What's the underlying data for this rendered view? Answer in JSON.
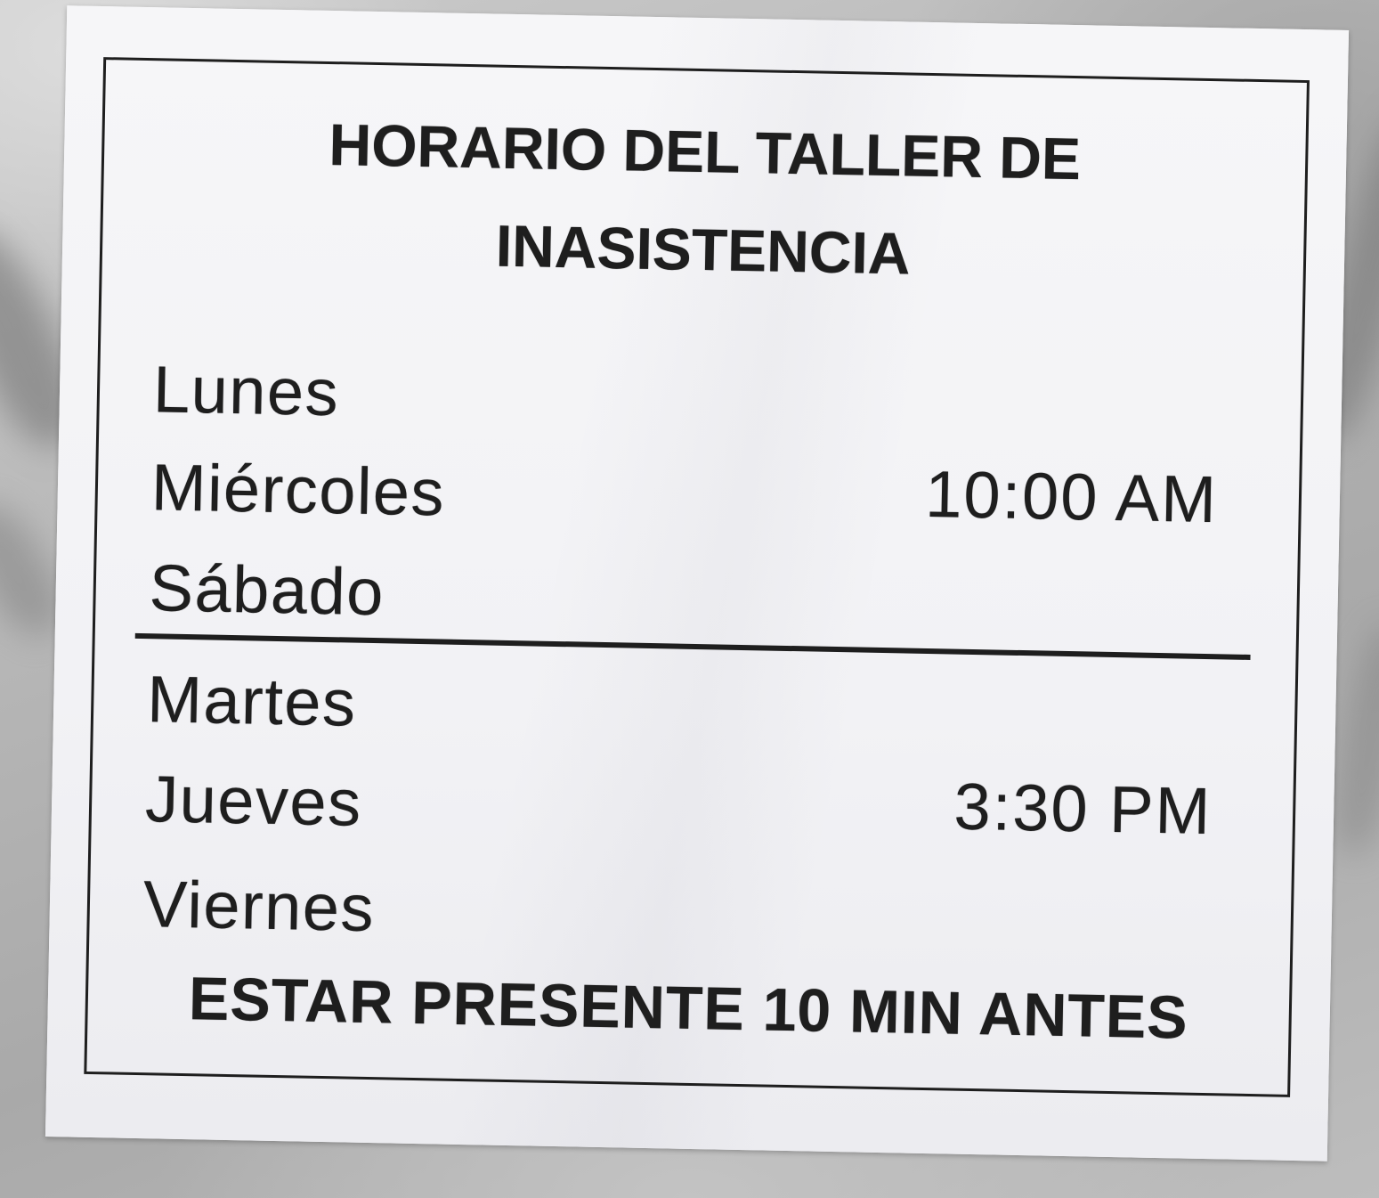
{
  "title": {
    "line1": "HORARIO DEL TALLER DE",
    "line2": "INASISTENCIA"
  },
  "schedule": [
    {
      "days": [
        "Lunes",
        "Miércoles",
        "Sábado"
      ],
      "time": "10:00 AM"
    },
    {
      "days": [
        "Martes",
        "Jueves",
        "Viernes"
      ],
      "time": "3:30 PM"
    }
  ],
  "note": "ESTAR PRESENTE 10 MIN ANTES",
  "colors": {
    "ink": "#1e1e1e",
    "paper": "#f4f4f6",
    "surface": "#b8b8b8"
  }
}
